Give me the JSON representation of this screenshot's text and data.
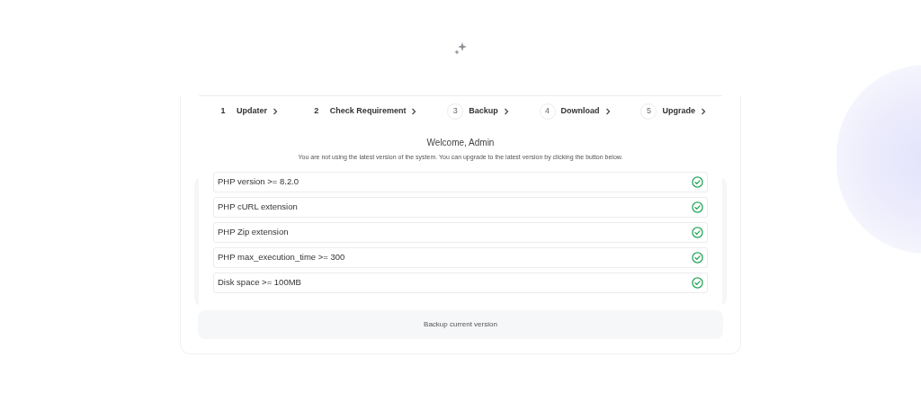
{
  "steps": [
    {
      "number": "1",
      "label": "Updater",
      "completed": true
    },
    {
      "number": "2",
      "label": "Check Requirement",
      "completed": true
    },
    {
      "number": "3",
      "label": "Backup",
      "completed": false
    },
    {
      "number": "4",
      "label": "Download",
      "completed": false
    },
    {
      "number": "5",
      "label": "Upgrade",
      "completed": false
    }
  ],
  "heading": "Welcome, Admin",
  "subtitle": "You are not using the latest version of the system. You can upgrade to the latest version by clicking the button below.",
  "requirements": [
    {
      "label": "PHP version >= 8.2.0",
      "passed": true
    },
    {
      "label": "PHP cURL extension",
      "passed": true
    },
    {
      "label": "PHP Zip extension",
      "passed": true
    },
    {
      "label": "PHP max_execution_time >= 300",
      "passed": true
    },
    {
      "label": "Disk space >= 100MB",
      "passed": true
    }
  ],
  "action_button": "Backup current version"
}
